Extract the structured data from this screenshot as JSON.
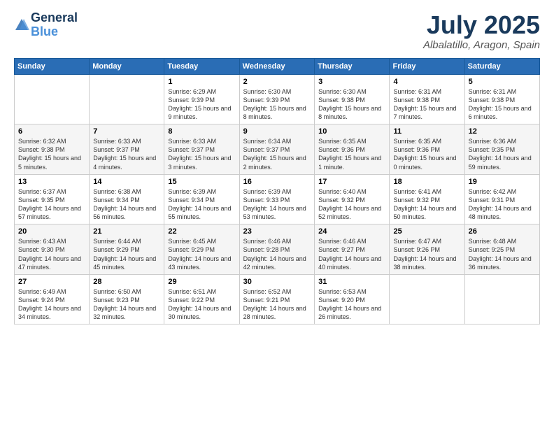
{
  "header": {
    "logo_line1": "General",
    "logo_line2": "Blue",
    "month": "July 2025",
    "location": "Albalatillo, Aragon, Spain"
  },
  "days_of_week": [
    "Sunday",
    "Monday",
    "Tuesday",
    "Wednesday",
    "Thursday",
    "Friday",
    "Saturday"
  ],
  "weeks": [
    [
      {
        "day": "",
        "info": ""
      },
      {
        "day": "",
        "info": ""
      },
      {
        "day": "1",
        "info": "Sunrise: 6:29 AM\nSunset: 9:39 PM\nDaylight: 15 hours and 9 minutes."
      },
      {
        "day": "2",
        "info": "Sunrise: 6:30 AM\nSunset: 9:39 PM\nDaylight: 15 hours and 8 minutes."
      },
      {
        "day": "3",
        "info": "Sunrise: 6:30 AM\nSunset: 9:38 PM\nDaylight: 15 hours and 8 minutes."
      },
      {
        "day": "4",
        "info": "Sunrise: 6:31 AM\nSunset: 9:38 PM\nDaylight: 15 hours and 7 minutes."
      },
      {
        "day": "5",
        "info": "Sunrise: 6:31 AM\nSunset: 9:38 PM\nDaylight: 15 hours and 6 minutes."
      }
    ],
    [
      {
        "day": "6",
        "info": "Sunrise: 6:32 AM\nSunset: 9:38 PM\nDaylight: 15 hours and 5 minutes."
      },
      {
        "day": "7",
        "info": "Sunrise: 6:33 AM\nSunset: 9:37 PM\nDaylight: 15 hours and 4 minutes."
      },
      {
        "day": "8",
        "info": "Sunrise: 6:33 AM\nSunset: 9:37 PM\nDaylight: 15 hours and 3 minutes."
      },
      {
        "day": "9",
        "info": "Sunrise: 6:34 AM\nSunset: 9:37 PM\nDaylight: 15 hours and 2 minutes."
      },
      {
        "day": "10",
        "info": "Sunrise: 6:35 AM\nSunset: 9:36 PM\nDaylight: 15 hours and 1 minute."
      },
      {
        "day": "11",
        "info": "Sunrise: 6:35 AM\nSunset: 9:36 PM\nDaylight: 15 hours and 0 minutes."
      },
      {
        "day": "12",
        "info": "Sunrise: 6:36 AM\nSunset: 9:35 PM\nDaylight: 14 hours and 59 minutes."
      }
    ],
    [
      {
        "day": "13",
        "info": "Sunrise: 6:37 AM\nSunset: 9:35 PM\nDaylight: 14 hours and 57 minutes."
      },
      {
        "day": "14",
        "info": "Sunrise: 6:38 AM\nSunset: 9:34 PM\nDaylight: 14 hours and 56 minutes."
      },
      {
        "day": "15",
        "info": "Sunrise: 6:39 AM\nSunset: 9:34 PM\nDaylight: 14 hours and 55 minutes."
      },
      {
        "day": "16",
        "info": "Sunrise: 6:39 AM\nSunset: 9:33 PM\nDaylight: 14 hours and 53 minutes."
      },
      {
        "day": "17",
        "info": "Sunrise: 6:40 AM\nSunset: 9:32 PM\nDaylight: 14 hours and 52 minutes."
      },
      {
        "day": "18",
        "info": "Sunrise: 6:41 AM\nSunset: 9:32 PM\nDaylight: 14 hours and 50 minutes."
      },
      {
        "day": "19",
        "info": "Sunrise: 6:42 AM\nSunset: 9:31 PM\nDaylight: 14 hours and 48 minutes."
      }
    ],
    [
      {
        "day": "20",
        "info": "Sunrise: 6:43 AM\nSunset: 9:30 PM\nDaylight: 14 hours and 47 minutes."
      },
      {
        "day": "21",
        "info": "Sunrise: 6:44 AM\nSunset: 9:29 PM\nDaylight: 14 hours and 45 minutes."
      },
      {
        "day": "22",
        "info": "Sunrise: 6:45 AM\nSunset: 9:29 PM\nDaylight: 14 hours and 43 minutes."
      },
      {
        "day": "23",
        "info": "Sunrise: 6:46 AM\nSunset: 9:28 PM\nDaylight: 14 hours and 42 minutes."
      },
      {
        "day": "24",
        "info": "Sunrise: 6:46 AM\nSunset: 9:27 PM\nDaylight: 14 hours and 40 minutes."
      },
      {
        "day": "25",
        "info": "Sunrise: 6:47 AM\nSunset: 9:26 PM\nDaylight: 14 hours and 38 minutes."
      },
      {
        "day": "26",
        "info": "Sunrise: 6:48 AM\nSunset: 9:25 PM\nDaylight: 14 hours and 36 minutes."
      }
    ],
    [
      {
        "day": "27",
        "info": "Sunrise: 6:49 AM\nSunset: 9:24 PM\nDaylight: 14 hours and 34 minutes."
      },
      {
        "day": "28",
        "info": "Sunrise: 6:50 AM\nSunset: 9:23 PM\nDaylight: 14 hours and 32 minutes."
      },
      {
        "day": "29",
        "info": "Sunrise: 6:51 AM\nSunset: 9:22 PM\nDaylight: 14 hours and 30 minutes."
      },
      {
        "day": "30",
        "info": "Sunrise: 6:52 AM\nSunset: 9:21 PM\nDaylight: 14 hours and 28 minutes."
      },
      {
        "day": "31",
        "info": "Sunrise: 6:53 AM\nSunset: 9:20 PM\nDaylight: 14 hours and 26 minutes."
      },
      {
        "day": "",
        "info": ""
      },
      {
        "day": "",
        "info": ""
      }
    ]
  ]
}
